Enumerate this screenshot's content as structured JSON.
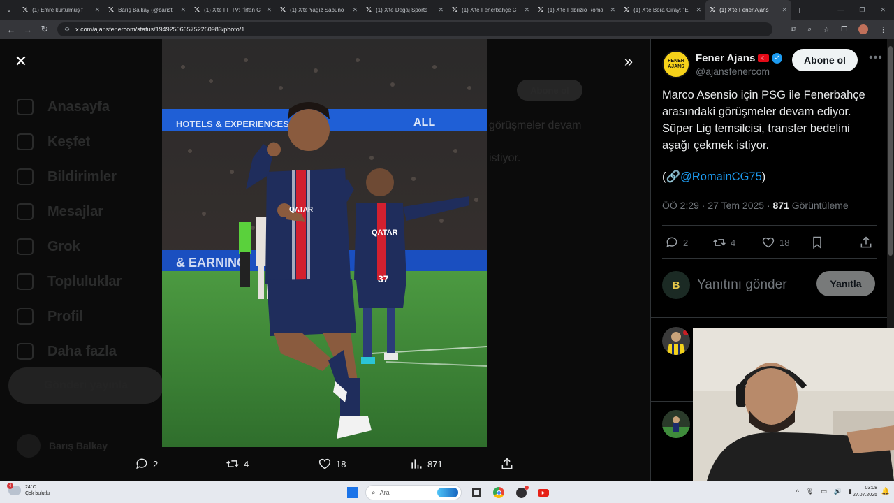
{
  "browser": {
    "tabs": [
      {
        "label": "(1) Emre kurtulmuş f",
        "active": false
      },
      {
        "label": "Barış Balkay (@barist",
        "active": false
      },
      {
        "label": "(1) X'te FF TV: \"İrfan C",
        "active": false
      },
      {
        "label": "(1) X'te Yağız Sabuno",
        "active": false
      },
      {
        "label": "(1) X'te Degaj Sports",
        "active": false
      },
      {
        "label": "(1) X'te Fenerbahçe C",
        "active": false
      },
      {
        "label": "(1) X'te Fabrizio Roma",
        "active": false
      },
      {
        "label": "(1) X'te Bora Giray: \"E",
        "active": false
      },
      {
        "label": "(1) X'te Fener Ajans",
        "active": true
      }
    ],
    "url": "x.com/ajansfenercom/status/1949250665752260983/photo/1"
  },
  "viewer": {
    "background_nav": [
      "Anasayfa",
      "Keşfet",
      "Bildirimler",
      "Mesajlar",
      "Grok",
      "Topluluklar",
      "Profil",
      "Daha fazla"
    ],
    "background_post_button": "Gönderi yayınla",
    "background_user": "Barış Balkay",
    "background_follow": "Abone ol",
    "background_text_1": "görüşmeler devam",
    "background_text_2": "istiyor.",
    "photo_alt": "Marco Asensio PSG celebration",
    "actions": {
      "replies": "2",
      "reposts": "4",
      "likes": "18",
      "views": "871"
    }
  },
  "tweet": {
    "author_name": "Fener Ajans",
    "author_handle": "@ajansfenercom",
    "avatar_text": "FENER AJANS",
    "follow_label": "Abone ol",
    "text": "Marco Asensio için PSG ile Fenerbahçe arasındaki görüşmeler devam ediyor. Süper Lig temsilcisi, transfer bedelini aşağı çekmek istiyor.",
    "credit_open": "(🔗",
    "credit_mention": "@RomainCG75",
    "credit_close": ")",
    "time": "ÖÖ 2:29 · 27 Tem 2025 · ",
    "views_count": "871",
    "views_label": " Görüntüleme",
    "stats": {
      "replies": "2",
      "reposts": "4",
      "likes": "18"
    },
    "reply_placeholder": "Yanıtını gönder",
    "reply_button": "Yanıtla",
    "reply_avatar_text": "B"
  },
  "taskbar": {
    "weather_temp": "24°C",
    "weather_desc": "Çok bulutlu",
    "weather_badge": "4",
    "search_placeholder": "Ara",
    "time": "03:08",
    "date": "27.07.2025"
  },
  "colors": {
    "accent": "#1d9bf0",
    "psg_navy": "#1f2d5c",
    "psg_red": "#d2202f",
    "pitch": "#3d8a3a"
  }
}
